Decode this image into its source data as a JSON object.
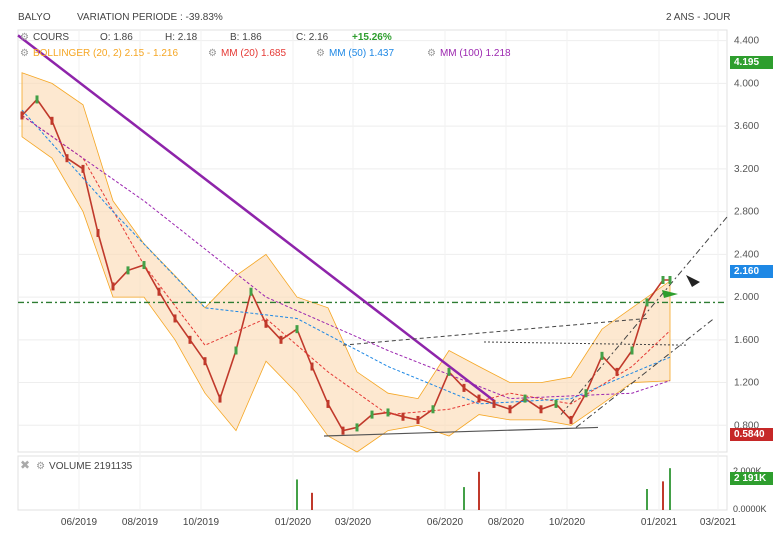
{
  "header": {
    "ticker": "BALYO",
    "variation": "VARIATION PERIODE : -39.83%",
    "period": "2 ANS - JOUR"
  },
  "quote": {
    "label": "COURS",
    "open": "O: 1.86",
    "high": "H: 2.18",
    "low": "B: 1.86",
    "close": "C: 2.16",
    "change": "+15.26%"
  },
  "indicators": [
    {
      "label": "BOLLINGER (20, 2)",
      "value": "2.15 - 1.216",
      "color": "#f5a623"
    },
    {
      "label": "MM (20)",
      "value": "1.685",
      "color": "#e53935"
    },
    {
      "label": "MM (50)",
      "value": "1.437",
      "color": "#1e88e5"
    },
    {
      "label": "MM (100)",
      "value": "1.218",
      "color": "#9c27b0"
    }
  ],
  "badges": {
    "high": "4.195",
    "last": "2.160",
    "low": "0.5840",
    "volume": "2 191K"
  },
  "volume_panel": {
    "label": "VOLUME",
    "value": "2191135",
    "axis_top": "2.000K",
    "axis_bottom": "0.0000K"
  },
  "chart_data": {
    "type": "line",
    "price_axis": {
      "ylim": [
        0.55,
        4.5
      ],
      "ticks": [
        "4.400",
        "4.000",
        "3.600",
        "3.200",
        "2.800",
        "2.400",
        "2.000",
        "1.600",
        "1.200",
        "0.800"
      ],
      "tick_values": [
        4.4,
        4.0,
        3.6,
        3.2,
        2.8,
        2.4,
        2.0,
        1.6,
        1.2,
        0.8
      ]
    },
    "x_axis": {
      "labels": [
        "06/2019",
        "08/2019",
        "10/2019",
        "01/2020",
        "03/2020",
        "06/2020",
        "08/2020",
        "10/2020",
        "01/2021",
        "03/2021"
      ],
      "label_dates": [
        "2019-06-01",
        "2019-08-01",
        "2019-10-01",
        "2020-01-01",
        "2020-03-01",
        "2020-06-01",
        "2020-08-01",
        "2020-10-01",
        "2021-01-01",
        "2021-03-01"
      ]
    },
    "series": [
      {
        "name": "COURS",
        "x": [
          "2019-04-05",
          "2019-04-20",
          "2019-05-05",
          "2019-05-20",
          "2019-06-05",
          "2019-06-20",
          "2019-07-05",
          "2019-07-20",
          "2019-08-05",
          "2019-08-20",
          "2019-09-05",
          "2019-09-20",
          "2019-10-05",
          "2019-10-20",
          "2019-11-05",
          "2019-11-20",
          "2019-12-05",
          "2019-12-20",
          "2020-01-05",
          "2020-01-20",
          "2020-02-05",
          "2020-02-20",
          "2020-03-05",
          "2020-03-20",
          "2020-04-05",
          "2020-04-20",
          "2020-05-05",
          "2020-05-20",
          "2020-06-05",
          "2020-06-20",
          "2020-07-05",
          "2020-07-20",
          "2020-08-05",
          "2020-08-20",
          "2020-09-05",
          "2020-09-20",
          "2020-10-05",
          "2020-10-20",
          "2020-11-05",
          "2020-11-20",
          "2020-12-05",
          "2020-12-20",
          "2021-01-05",
          "2021-01-12"
        ],
        "values": [
          3.7,
          3.85,
          3.65,
          3.3,
          3.2,
          2.6,
          2.1,
          2.25,
          2.3,
          2.05,
          1.8,
          1.6,
          1.4,
          1.05,
          1.5,
          2.05,
          1.75,
          1.6,
          1.7,
          1.35,
          1.0,
          0.75,
          0.78,
          0.9,
          0.92,
          0.88,
          0.85,
          0.95,
          1.3,
          1.15,
          1.05,
          1.0,
          0.95,
          1.05,
          0.95,
          1.0,
          0.85,
          1.1,
          1.45,
          1.3,
          1.5,
          1.95,
          2.16,
          2.16
        ]
      },
      {
        "name": "MM (20)",
        "x": [
          "2019-04-05",
          "2019-06-05",
          "2019-08-05",
          "2019-10-05",
          "2019-12-05",
          "2020-02-05",
          "2020-04-05",
          "2020-06-05",
          "2020-08-05",
          "2020-10-05",
          "2020-12-05",
          "2021-01-12"
        ],
        "values": [
          3.7,
          3.3,
          2.3,
          1.55,
          1.8,
          1.3,
          0.9,
          0.95,
          1.1,
          1.0,
          1.35,
          1.685
        ]
      },
      {
        "name": "MM (50)",
        "x": [
          "2019-04-05",
          "2019-07-05",
          "2019-10-05",
          "2020-01-05",
          "2020-04-05",
          "2020-07-05",
          "2020-10-05",
          "2021-01-12"
        ],
        "values": [
          3.75,
          2.8,
          1.9,
          1.8,
          1.35,
          1.0,
          1.05,
          1.437
        ]
      },
      {
        "name": "MM (100)",
        "x": [
          "2019-04-05",
          "2019-08-05",
          "2019-12-05",
          "2020-04-05",
          "2020-08-05",
          "2020-12-05",
          "2021-01-12"
        ],
        "values": [
          3.7,
          2.9,
          2.0,
          1.5,
          1.05,
          1.1,
          1.218
        ]
      }
    ],
    "bollinger": {
      "x": [
        "2019-04-05",
        "2019-05-05",
        "2019-06-05",
        "2019-07-05",
        "2019-08-05",
        "2019-09-05",
        "2019-10-05",
        "2019-11-05",
        "2019-12-05",
        "2020-01-05",
        "2020-02-05",
        "2020-03-05",
        "2020-04-05",
        "2020-05-05",
        "2020-06-05",
        "2020-07-05",
        "2020-08-05",
        "2020-09-05",
        "2020-10-05",
        "2020-11-05",
        "2020-12-05",
        "2021-01-12"
      ],
      "upper": [
        4.1,
        4.0,
        3.8,
        2.9,
        2.5,
        2.2,
        1.9,
        2.2,
        2.4,
        2.0,
        1.9,
        1.3,
        1.1,
        1.05,
        1.5,
        1.35,
        1.2,
        1.2,
        1.25,
        1.7,
        1.9,
        2.15
      ],
      "lower": [
        3.5,
        3.3,
        2.8,
        2.0,
        2.0,
        1.6,
        1.1,
        0.75,
        1.4,
        1.1,
        0.7,
        0.55,
        0.75,
        0.8,
        0.7,
        0.9,
        0.85,
        0.85,
        0.8,
        1.0,
        1.2,
        1.216
      ]
    },
    "volume": {
      "x": [
        "2020-01-05",
        "2020-01-20",
        "2020-06-20",
        "2020-07-05",
        "2020-12-20",
        "2021-01-05",
        "2021-01-12"
      ],
      "values": [
        1600,
        900,
        1200,
        2000,
        1100,
        1500,
        2191
      ]
    },
    "annotations": {
      "resistance_level": 1.95,
      "downtrend": {
        "from": [
          "2019-04-01",
          4.45
        ],
        "to": [
          "2020-07-20",
          1.03
        ]
      },
      "support": {
        "from": [
          "2020-02-01",
          0.7
        ],
        "to": [
          "2020-11-01",
          0.78
        ]
      }
    },
    "legend_position": "top-left",
    "grid": true
  }
}
